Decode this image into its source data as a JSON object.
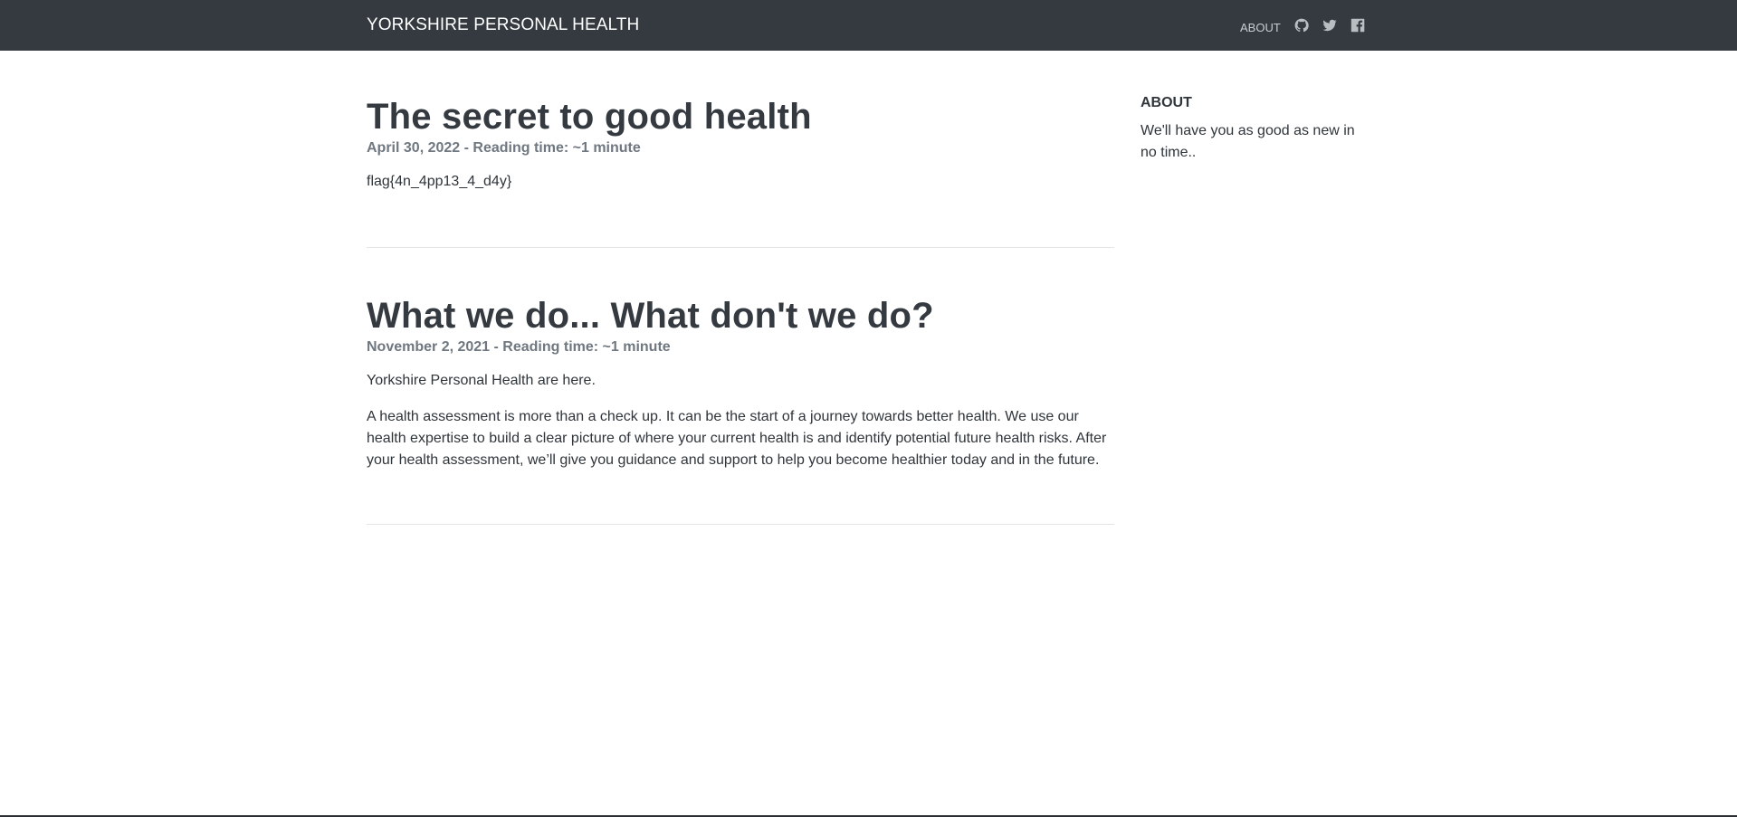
{
  "header": {
    "brand": "YORKSHIRE PERSONAL HEALTH",
    "about_link": "ABOUT",
    "icons": [
      "github-icon",
      "twitter-icon",
      "facebook-icon"
    ]
  },
  "posts": [
    {
      "title": "The secret to good health",
      "meta": "April 30, 2022 - Reading time: ~1 minute",
      "paragraphs": [
        "flag{4n_4pp13_4_d4y}"
      ]
    },
    {
      "title": "What we do... What don't we do?",
      "meta": "November 2, 2021 - Reading time: ~1 minute",
      "paragraphs": [
        "Yorkshire Personal Health are here.",
        "A health assessment is more than a check up. It can be the start of a journey towards better health. We use our health expertise to build a clear picture of where your current health is and identify potential future health risks. After your health assessment, we’ll give you guidance and support to help you become healthier today and in the future."
      ]
    }
  ],
  "sidebar": {
    "heading": "ABOUT",
    "text": "We'll have you as good as new in no time.."
  },
  "colors": {
    "navbar": "#343a40",
    "text": "#343a40",
    "meta": "#6f7780"
  }
}
